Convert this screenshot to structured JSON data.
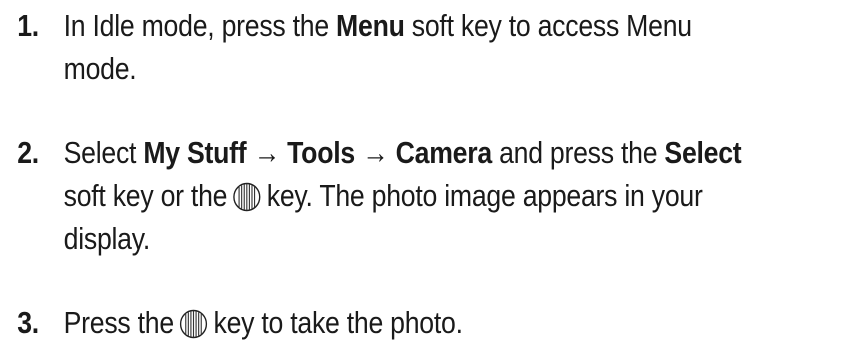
{
  "steps": [
    {
      "number": "1.",
      "line1_a": "In Idle mode, press the ",
      "line1_b": "Menu",
      "line1_c": " soft key to access Menu",
      "line2": "mode."
    },
    {
      "number": "2.",
      "line1_a": "Select ",
      "line1_b": "My Stuff",
      "arrow1": " → ",
      "line1_c": "Tools",
      "arrow2": " → ",
      "line1_d": "Camera",
      "line1_e": " and press the ",
      "line1_f": "Select",
      "line2_a": "soft key or the",
      "line2_b": "key. The photo image appears in your",
      "line3": "display."
    },
    {
      "number": "3.",
      "line1_a": "Press the",
      "line1_b": "key to take the photo."
    }
  ],
  "icons": {
    "key": "center-select-key-icon"
  }
}
